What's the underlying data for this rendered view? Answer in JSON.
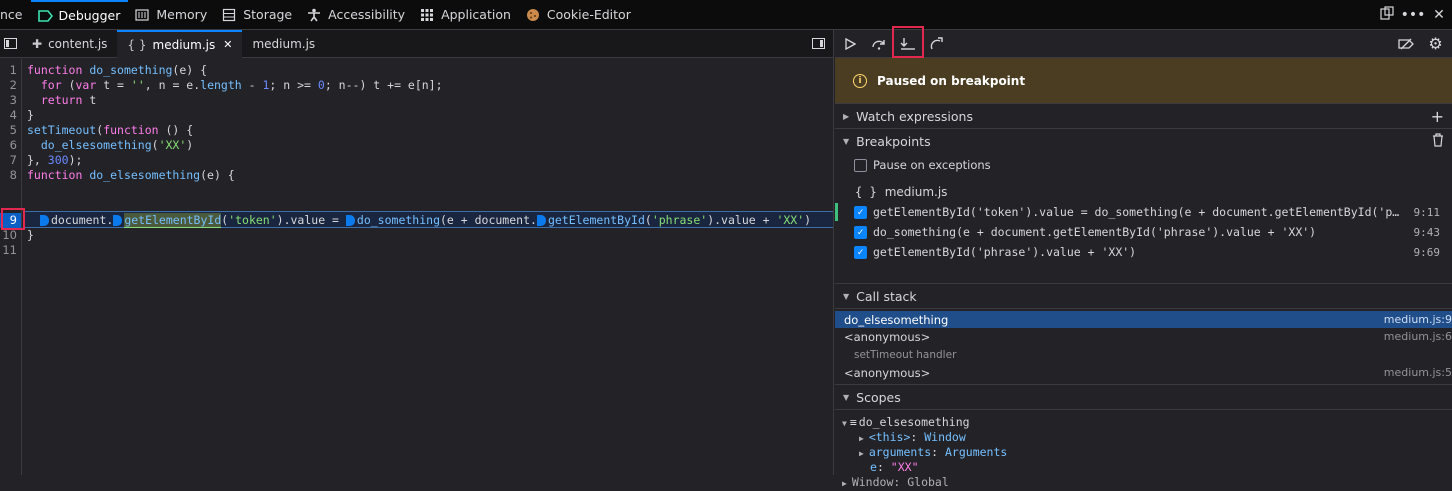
{
  "toolbar": {
    "tabs": [
      {
        "label": "nce",
        "icon": "",
        "selected": false
      },
      {
        "label": "Debugger",
        "icon": "debugger-icon",
        "selected": true
      },
      {
        "label": "Memory",
        "icon": "memory-icon",
        "selected": false
      },
      {
        "label": "Storage",
        "icon": "storage-icon",
        "selected": false
      },
      {
        "label": "Accessibility",
        "icon": "accessibility-icon",
        "selected": false
      },
      {
        "label": "Application",
        "icon": "application-icon",
        "selected": false
      },
      {
        "label": "Cookie-Editor",
        "icon": "cookie-icon",
        "selected": false
      }
    ]
  },
  "sources": {
    "tabs": [
      {
        "label": "content.js",
        "icon": "puzzle-icon"
      },
      {
        "label": "medium.js",
        "icon": "braces-icon",
        "selected": true
      },
      {
        "label": "medium.js",
        "icon": ""
      }
    ]
  },
  "editor": {
    "line_numbers": [
      "1",
      "2",
      "3",
      "4",
      "5",
      "6",
      "7",
      "8",
      "9",
      "10",
      "11"
    ],
    "paused_line": "9",
    "lines": [
      "function do_something(e) {",
      "  for (var t = '', n = e.length - 1; n >= 0; n--) t += e[n];",
      "  return t",
      "}",
      "setTimeout(function () {",
      "  do_elsesomething('XX')",
      "}, 300);",
      "function do_elsesomething(e) {",
      "  document.getElementById('token').value = do_something(e + document.getElementById('phrase').value + 'XX')",
      "}",
      ""
    ]
  },
  "debug_panel": {
    "paused_message": "Paused on breakpoint",
    "watch_label": "Watch expressions",
    "breakpoints_label": "Breakpoints",
    "pause_exceptions_label": "Pause on exceptions",
    "bp_file": "medium.js",
    "breakpoints": [
      {
        "text": "getElementById('token').value = do_something(e + document.getElementById('phrase').value + 'XX')",
        "loc": "9:11"
      },
      {
        "text": "do_something(e + document.getElementById('phrase').value + 'XX')",
        "loc": "9:43"
      },
      {
        "text": "getElementById('phrase').value + 'XX')",
        "loc": "9:69"
      }
    ],
    "callstack_label": "Call stack",
    "frames": [
      {
        "name": "do_elsesomething",
        "loc": "medium.js:9",
        "selected": true
      },
      {
        "name": "<anonymous>",
        "loc": "medium.js:6"
      },
      {
        "name": "setTimeout handler",
        "loc": ""
      },
      {
        "name": "<anonymous>",
        "loc": "medium.js:5"
      }
    ],
    "scopes_label": "Scopes",
    "scope_fn": "do_elsesomething",
    "scope_this_key": "<this>",
    "scope_this_val": "Window",
    "scope_args_key": "arguments",
    "scope_args_val": "Arguments",
    "scope_e_key": "e",
    "scope_e_val": "\"XX\"",
    "scope_window": "Window: Global"
  },
  "colors": {
    "accent": "#0a84ff",
    "highlight_box": "#e22850",
    "paused_banner": "#4a3d22"
  }
}
